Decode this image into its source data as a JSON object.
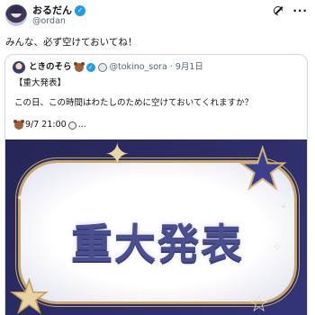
{
  "author": {
    "display_name": "おるだん",
    "handle": "@ordan"
  },
  "tweet_text": "みんな、必ず空けておいてね！",
  "quote": {
    "display_name": "ときのそら",
    "handle": "@tokino_sora",
    "dot": "·",
    "date": "9月1日",
    "line1": "【重大発表】",
    "line2": "この日、この時間はわたしのために空けておいてくれますか？",
    "line3": "9/7 21:00",
    "line3_suffix": "...",
    "image_text": "重大発表"
  },
  "icons": {
    "verified": "verified-badge-icon",
    "grok": "grok-icon",
    "more": "more-options-icon",
    "bear": "bear-icon",
    "clock": "clock-icon"
  },
  "colors": {
    "verified": "#1d9bf0",
    "secondary_text": "#536471",
    "banner_bg": "#2b2c5e",
    "headline": "#4c4f8f"
  }
}
